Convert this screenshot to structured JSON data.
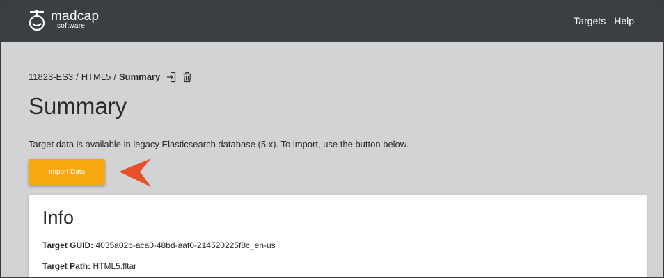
{
  "header": {
    "logo": {
      "wordmark": "madcap",
      "subtext": "software"
    },
    "nav": {
      "targets": "Targets",
      "help": "Help"
    }
  },
  "breadcrumb": {
    "project": "11823-ES3",
    "separator": "/",
    "target": "HTML5",
    "current": "Summary",
    "icons": [
      "export-icon",
      "trash-icon"
    ]
  },
  "main": {
    "title": "Summary",
    "message": "Target data is available in legacy Elasticsearch database (5.x). To import, use the button below.",
    "import_button": "Import Data"
  },
  "info": {
    "title": "Info",
    "rows": [
      {
        "label": "Target GUID:",
        "value": "4035a02b-aca0-48bd-aaf0-214520225f8c_en-us"
      },
      {
        "label": "Target Path:",
        "value": "HTML5.fltar"
      }
    ]
  },
  "colors": {
    "header_bg": "#3b3f43",
    "page_bg": "#d1d3d4",
    "accent": "#f7a80e",
    "callout_arrow": "#e8502a"
  }
}
